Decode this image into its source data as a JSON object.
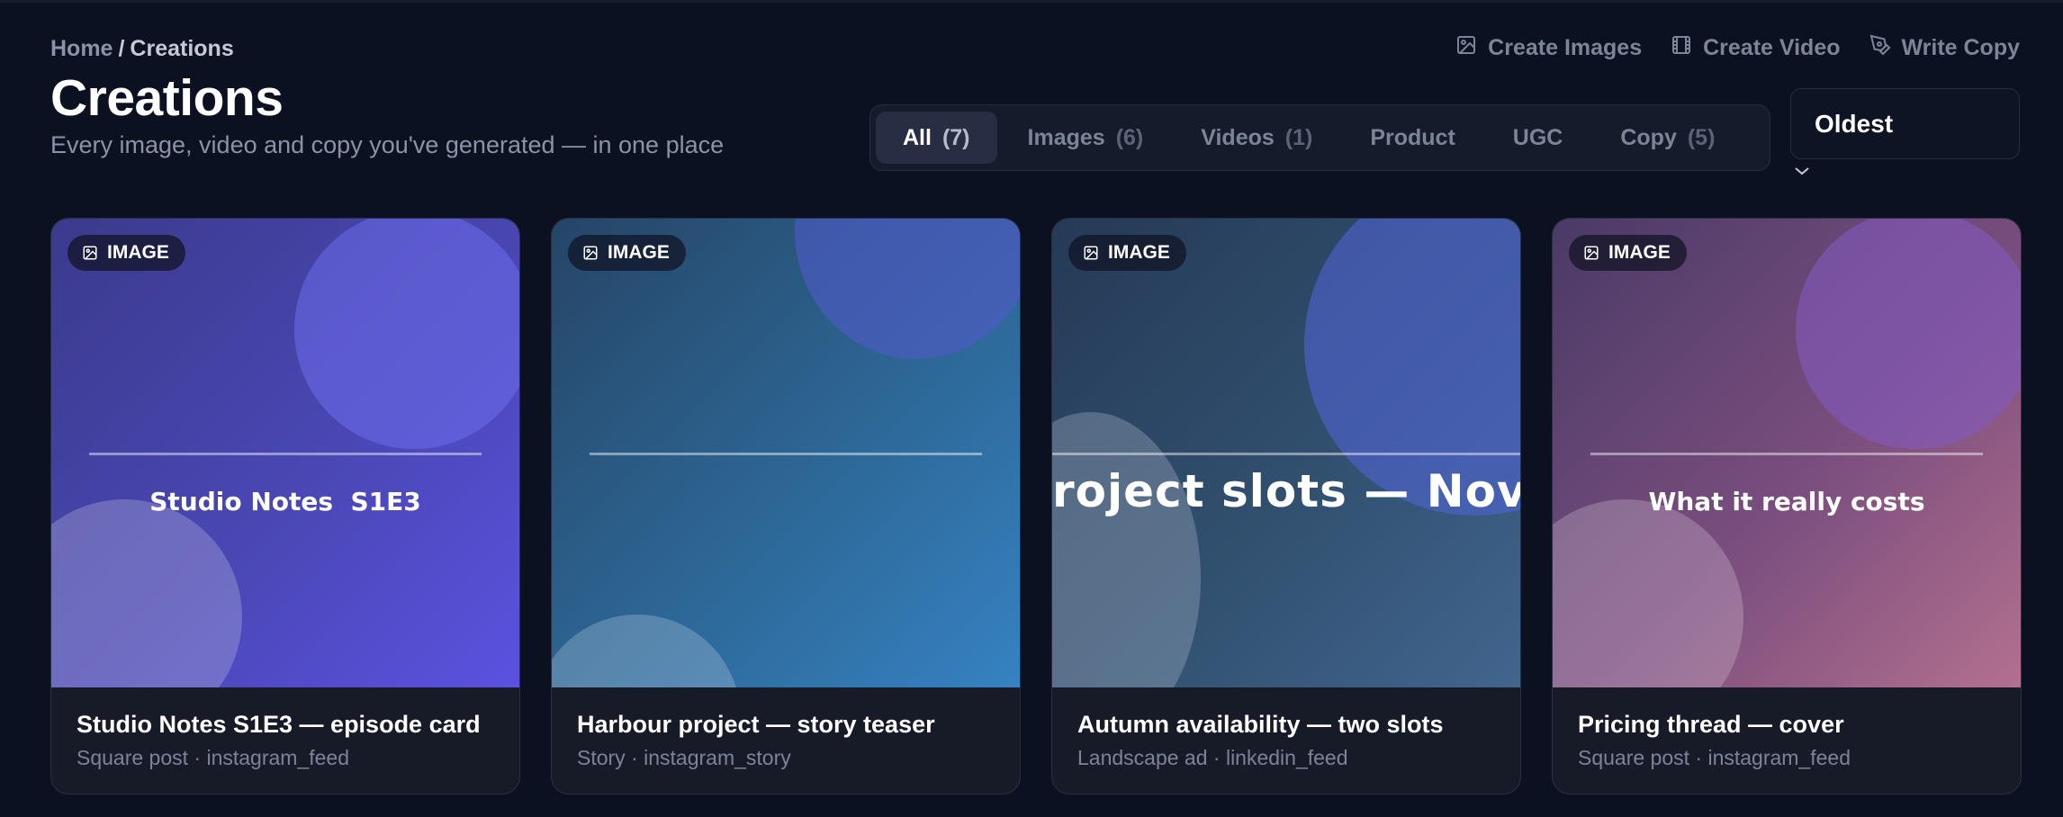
{
  "breadcrumb": {
    "home": "Home",
    "separator": "/",
    "current": "Creations"
  },
  "header": {
    "title": "Creations",
    "subtitle": "Every image, video and copy you've generated — in one place"
  },
  "actions": [
    {
      "label": "Create Images",
      "icon": "image-icon"
    },
    {
      "label": "Create Video",
      "icon": "film-icon"
    },
    {
      "label": "Write Copy",
      "icon": "pen-icon"
    }
  ],
  "filters": [
    {
      "label": "All",
      "count": "(7)",
      "active": true
    },
    {
      "label": "Images",
      "count": "(6)"
    },
    {
      "label": "Videos",
      "count": "(1)"
    },
    {
      "label": "Product",
      "count": ""
    },
    {
      "label": "UGC",
      "count": ""
    },
    {
      "label": "Copy",
      "count": "(5)"
    }
  ],
  "sort": {
    "value": "Oldest"
  },
  "cards": [
    {
      "badge": "IMAGE",
      "caption": "Studio Notes  S1E3",
      "title": "Studio Notes S1E3 — episode card",
      "subtitle": "Square post · instagram_feed"
    },
    {
      "badge": "IMAGE",
      "caption": "",
      "title": "Harbour project — story teaser",
      "subtitle": "Story · instagram_story"
    },
    {
      "badge": "IMAGE",
      "caption": "roject slots — Nove",
      "title": "Autumn availability — two slots",
      "subtitle": "Landscape ad · linkedin_feed"
    },
    {
      "badge": "IMAGE",
      "caption": "What it really costs",
      "title": "Pricing thread — cover",
      "subtitle": "Square post · instagram_feed"
    }
  ]
}
